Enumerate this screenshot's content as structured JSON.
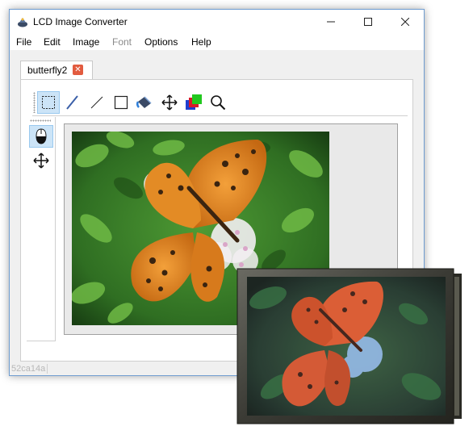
{
  "window": {
    "title": "LCD Image Converter",
    "controls": {
      "minimize_icon": "minimize-icon",
      "maximize_icon": "maximize-icon",
      "close_icon": "close-icon"
    }
  },
  "menu": {
    "items": [
      {
        "label": "File",
        "enabled": true
      },
      {
        "label": "Edit",
        "enabled": true
      },
      {
        "label": "Image",
        "enabled": true
      },
      {
        "label": "Font",
        "enabled": false
      },
      {
        "label": "Options",
        "enabled": true
      },
      {
        "label": "Help",
        "enabled": true
      }
    ]
  },
  "tabs": [
    {
      "label": "butterfly2",
      "active": true,
      "close_icon": "close-tab-icon"
    }
  ],
  "toolbar": {
    "tools": [
      {
        "icon": "selection-rectangle-icon",
        "active": true
      },
      {
        "icon": "pen-icon",
        "active": false
      },
      {
        "icon": "line-icon",
        "active": false
      },
      {
        "icon": "rectangle-icon",
        "active": false
      },
      {
        "icon": "fill-bucket-icon",
        "active": false
      },
      {
        "icon": "move-arrows-icon",
        "active": false
      },
      {
        "icon": "color-swatches-icon",
        "active": false
      },
      {
        "icon": "zoom-icon",
        "active": false
      }
    ]
  },
  "side_tools": [
    {
      "icon": "mouse-icon",
      "active": true
    },
    {
      "icon": "move-arrows-icon",
      "active": false
    }
  ],
  "status": {
    "text": "52ca14a"
  },
  "colors": {
    "accent": "#6e9cd0",
    "active_tool_bg": "#cce4f7",
    "tab_close": "#e25b3f",
    "butterfly": "#e08a1e",
    "foliage": "#3f8a2a"
  },
  "images": {
    "main_photo": "butterfly-photo",
    "device_photo": "lcd-device-photo"
  }
}
